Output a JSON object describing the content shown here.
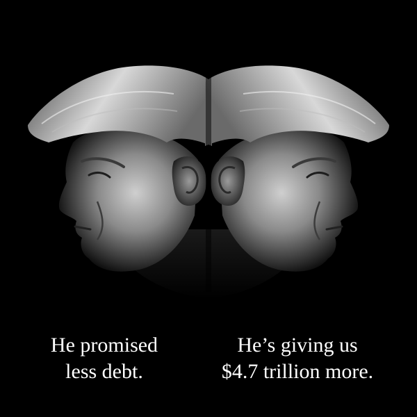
{
  "poster": {
    "image_description_icon": "mirrored-profile-portrait-icon",
    "background_color": "#000000",
    "text_color": "#ffffff"
  },
  "captions": {
    "left": {
      "line1": "He promised",
      "line2": "less debt."
    },
    "right": {
      "line1": "He’s giving us",
      "line2": "$4.7 trillion more."
    }
  }
}
